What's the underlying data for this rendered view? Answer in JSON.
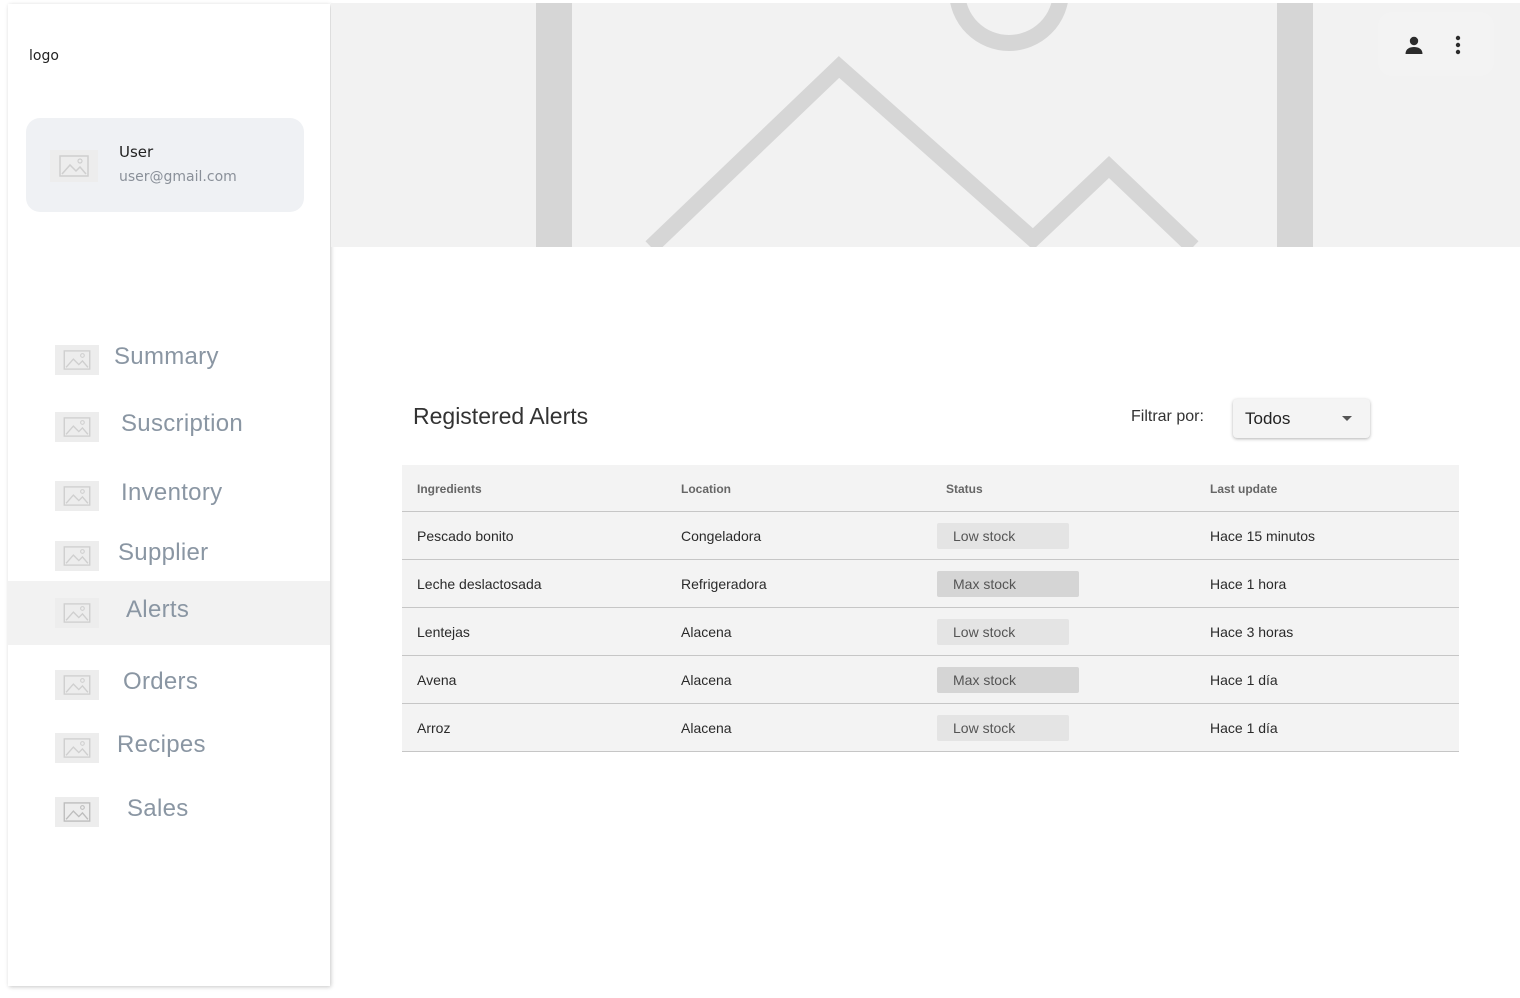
{
  "sidebar": {
    "logo": "logo",
    "user": {
      "name": "User",
      "email": "user@gmail.com"
    },
    "items": [
      {
        "label": "Summary"
      },
      {
        "label": "Suscription"
      },
      {
        "label": "Inventory"
      },
      {
        "label": "Supplier"
      },
      {
        "label": "Alerts",
        "active": true
      },
      {
        "label": "Orders"
      },
      {
        "label": "Recipes"
      },
      {
        "label": "Sales"
      }
    ]
  },
  "header": {
    "icons": [
      "person-icon",
      "more-vert-icon"
    ]
  },
  "main": {
    "title": "Registered Alerts",
    "filter": {
      "label": "Filtrar por:",
      "value": "Todos"
    },
    "table": {
      "headers": [
        "Ingredients",
        "Location",
        "Status",
        "Last update"
      ],
      "rows": [
        [
          "Pescado bonito",
          "Congeladora",
          "Low stock",
          "Hace 15 minutos"
        ],
        [
          "Leche deslactosada",
          "Refrigeradora",
          "Max stock",
          "Hace 1 hora"
        ],
        [
          "Lentejas",
          "Alacena",
          "Low stock",
          "Hace 3 horas"
        ],
        [
          "Avena",
          "Alacena",
          "Max stock",
          "Hace 1 día"
        ],
        [
          "Arroz",
          "Alacena",
          "Low stock",
          "Hace 1 día"
        ]
      ]
    }
  }
}
